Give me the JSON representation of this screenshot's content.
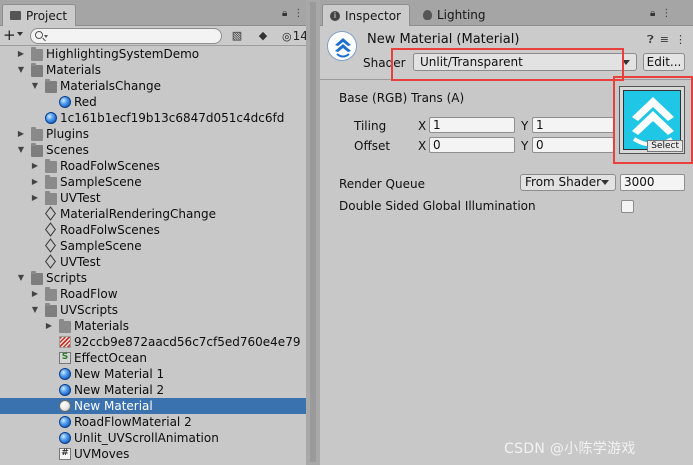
{
  "project": {
    "tab_label": "Project",
    "search_placeholder": "",
    "hidden_count": "14",
    "tree": [
      {
        "label": "HighlightingSystemDemo",
        "icon": "folder-icon",
        "expanded": false
      },
      {
        "label": "Materials",
        "icon": "folder-open-icon",
        "expanded": true
      },
      {
        "label": "MaterialsChange",
        "icon": "folder-open-icon",
        "expanded": true
      },
      {
        "label": "Red",
        "icon": "material-sphere-icon"
      },
      {
        "label": "1c161b1ecf19b13c6847d051c4dc6fd",
        "icon": "material-sphere-icon"
      },
      {
        "label": "Plugins",
        "icon": "folder-icon",
        "expanded": false
      },
      {
        "label": "Scenes",
        "icon": "folder-open-icon",
        "expanded": true
      },
      {
        "label": "RoadFolwScenes",
        "icon": "folder-icon",
        "expanded": false
      },
      {
        "label": "SampleScene",
        "icon": "folder-icon",
        "expanded": false
      },
      {
        "label": "UVTest",
        "icon": "folder-icon",
        "expanded": false
      },
      {
        "label": "MaterialRenderingChange",
        "icon": "scene-icon"
      },
      {
        "label": "RoadFolwScenes",
        "icon": "scene-icon"
      },
      {
        "label": "SampleScene",
        "icon": "scene-icon"
      },
      {
        "label": "UVTest",
        "icon": "scene-icon"
      },
      {
        "label": "Scripts",
        "icon": "folder-open-icon",
        "expanded": true
      },
      {
        "label": "RoadFlow",
        "icon": "folder-icon",
        "expanded": false
      },
      {
        "label": "UVScripts",
        "icon": "folder-open-icon",
        "expanded": true
      },
      {
        "label": "Materials",
        "icon": "folder-icon",
        "expanded": false
      },
      {
        "label": "92ccb9e872aacd56c7cf5ed760e4e79",
        "icon": "texture-icon"
      },
      {
        "label": "EffectOcean",
        "icon": "shader-icon"
      },
      {
        "label": "New Material 1",
        "icon": "material-sphere-icon"
      },
      {
        "label": "New Material 2",
        "icon": "material-sphere-icon"
      },
      {
        "label": "New Material",
        "icon": "material-sphere-white-icon",
        "selected": true
      },
      {
        "label": "RoadFlowMaterial 2",
        "icon": "material-sphere-icon"
      },
      {
        "label": "Unlit_UVScrollAnimation",
        "icon": "material-sphere-icon"
      },
      {
        "label": "UVMoves",
        "icon": "script-icon"
      }
    ]
  },
  "inspector": {
    "tab_label": "Inspector",
    "lighting_tab_label": "Lighting",
    "material_title": "New Material (Material)",
    "shader_label": "Shader",
    "shader_value": "Unlit/Transparent",
    "edit_label": "Edit...",
    "base_label": "Base (RGB) Trans (A)",
    "tiling_label": "Tiling",
    "offset_label": "Offset",
    "x_axis": "X",
    "y_axis": "Y",
    "tiling_x": "1",
    "tiling_y": "1",
    "offset_x": "0",
    "offset_y": "0",
    "select_label": "Select",
    "render_queue_label": "Render Queue",
    "render_queue_mode": "From Shader",
    "render_queue_value": "3000",
    "gi_label": "Double Sided Global Illumination",
    "gi_checked": false
  },
  "watermark": "CSDN @小陈学游戏",
  "colors": {
    "selection": "#3a72b0",
    "highlight_box": "#e8413d",
    "texture_cyan": "#1fc6e6"
  }
}
